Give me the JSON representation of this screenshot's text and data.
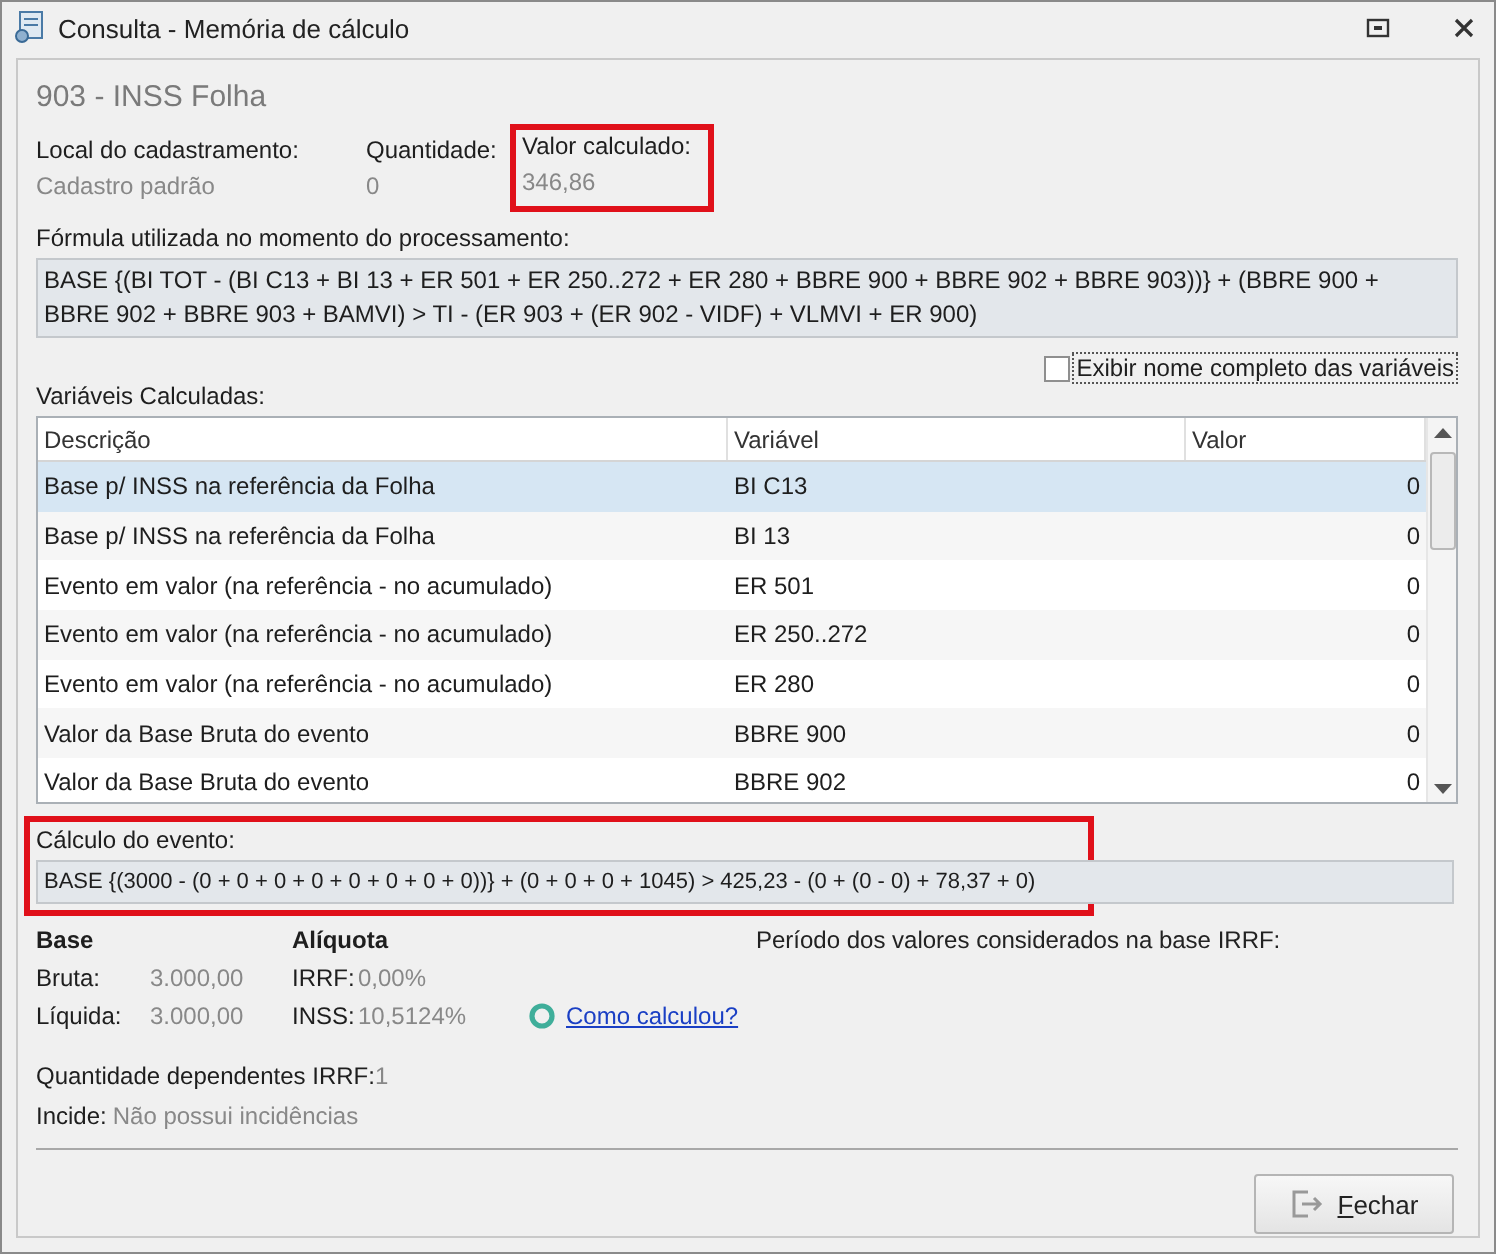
{
  "window": {
    "title": "Consulta - Memória de cálculo"
  },
  "heading": "903 - INSS Folha",
  "info": [
    {
      "label": "Local do cadastramento:",
      "value": "Cadastro padrão",
      "highlighted": false
    },
    {
      "label": "Quantidade:",
      "value": "0",
      "highlighted": false
    },
    {
      "label": "Valor calculado:",
      "value": "346,86",
      "highlighted": true
    }
  ],
  "formula": {
    "label": "Fórmula utilizada no momento do processamento:",
    "text": "BASE {(BI TOT - (BI C13 + BI 13 + ER 501 + ER 250..272 + ER 280 + BBRE 900 + BBRE 902 + BBRE 903))} + (BBRE 900 + BBRE 902 + BBRE 903 + BAMVI) > TI - (ER 903 + (ER 902 - VIDF) + VLMVI + ER 900)"
  },
  "full_names_checkbox": {
    "label": "Exibir nome completo das variáveis",
    "checked": false
  },
  "variables": {
    "label": "Variáveis Calculadas:",
    "columns": [
      "Descrição",
      "Variável",
      "Valor"
    ],
    "rows": [
      {
        "cells": [
          "Base p/ INSS na referência da Folha",
          "BI C13",
          "0"
        ],
        "selected": true
      },
      {
        "cells": [
          "Base p/ INSS na referência da Folha",
          "BI 13",
          "0"
        ],
        "selected": false
      },
      {
        "cells": [
          "Evento em valor (na referência - no acumulado)",
          "ER 501",
          "0"
        ],
        "selected": false
      },
      {
        "cells": [
          "Evento em valor (na referência - no acumulado)",
          "ER 250..272",
          "0"
        ],
        "selected": false
      },
      {
        "cells": [
          "Evento em valor (na referência - no acumulado)",
          "ER 280",
          "0"
        ],
        "selected": false
      },
      {
        "cells": [
          "Valor da Base Bruta do evento",
          "BBRE 900",
          "0"
        ],
        "selected": false
      },
      {
        "cells": [
          "Valor da Base Bruta do evento",
          "BBRE 902",
          "0"
        ],
        "selected": false
      }
    ]
  },
  "calculation": {
    "label": "Cálculo do evento:",
    "text": "BASE {(3000 - (0 + 0 + 0 + 0 + 0 + 0 + 0 + 0))} + (0 + 0 + 0 + 1045) > 425,23 - (0 + (0 - 0) + 78,37 + 0)",
    "highlighted": true
  },
  "base": {
    "title": "Base",
    "rows": [
      {
        "label": "Bruta:",
        "value": "3.000,00"
      },
      {
        "label": "Líquida:",
        "value": "3.000,00"
      }
    ]
  },
  "rate": {
    "title": "Alíquota",
    "rows": [
      {
        "label": "IRRF:",
        "value": "0,00%"
      },
      {
        "label": "INSS:",
        "value": "10,5124%"
      }
    ],
    "link": "Como calculou?"
  },
  "irrf_period_label": "Período dos valores considerados na base IRRF:",
  "dependents": {
    "label": "Quantidade dependentes IRRF:",
    "value": "1"
  },
  "incide": {
    "label": "Incide:",
    "value": "Não possui incidências"
  },
  "buttons": [
    {
      "label": "Fechar"
    }
  ]
}
